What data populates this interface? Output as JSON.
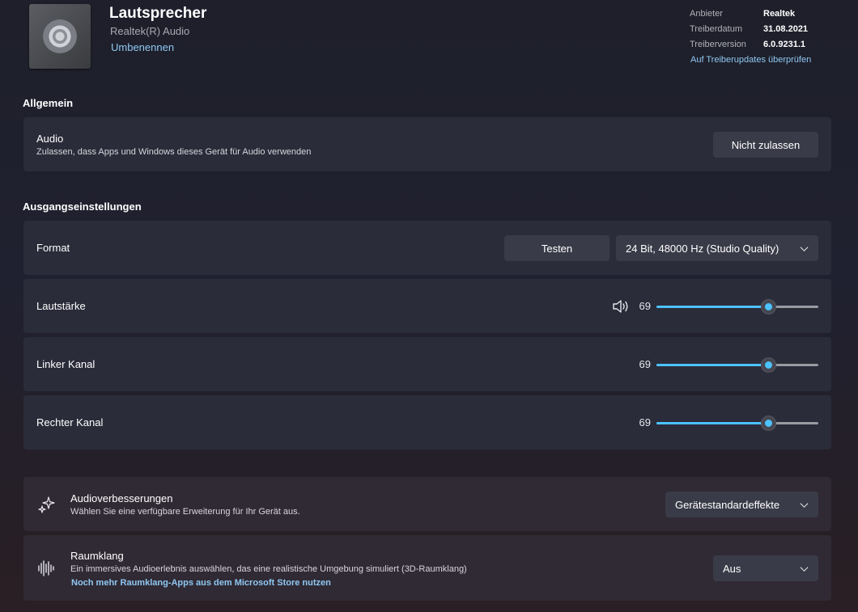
{
  "header": {
    "device_name": "Lautsprecher",
    "device_subtitle": "Realtek(R) Audio",
    "rename_link": "Umbenennen",
    "meta": [
      {
        "label": "Anbieter",
        "value": "Realtek"
      },
      {
        "label": "Treiberdatum",
        "value": "31.08.2021"
      },
      {
        "label": "Treiberversion",
        "value": "6.0.9231.1"
      }
    ],
    "driver_update_link": "Auf Treiberupdates überprüfen"
  },
  "general": {
    "heading": "Allgemein",
    "audio": {
      "title": "Audio",
      "description": "Zulassen, dass Apps und Windows dieses Gerät für Audio verwenden",
      "button": "Nicht zulassen"
    }
  },
  "output": {
    "heading": "Ausgangseinstellungen",
    "format": {
      "label": "Format",
      "test_button": "Testen",
      "selected": "24 Bit, 48000 Hz (Studio Quality)"
    },
    "volume": {
      "label": "Lautstärke",
      "value": "69",
      "level": 69
    },
    "left_channel": {
      "label": "Linker Kanal",
      "value": "69",
      "level": 69
    },
    "right_channel": {
      "label": "Rechter Kanal",
      "value": "69",
      "level": 69
    }
  },
  "enhancements": {
    "title": "Audioverbesserungen",
    "description": "Wählen Sie eine verfügbare Erweiterung für Ihr Gerät aus.",
    "selected": "Gerätestandardeffekte"
  },
  "spatial": {
    "title": "Raumklang",
    "description": "Ein immersives Audioerlebnis auswählen, das eine realistische Umgebung simuliert (3D-Raumklang)",
    "store_link": "Noch mehr Raumklang-Apps aus dem Microsoft Store nutzen",
    "selected": "Aus"
  },
  "colors": {
    "accent": "#4cc2ff",
    "link": "#8fc8f2"
  }
}
